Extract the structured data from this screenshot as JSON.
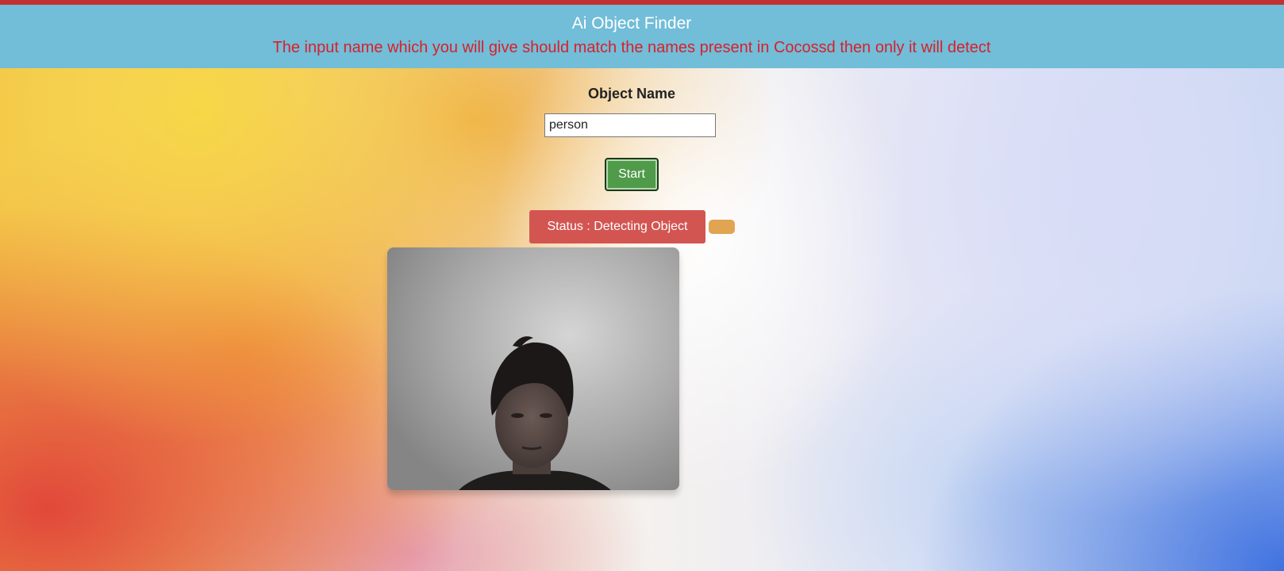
{
  "header": {
    "title": "Ai Object Finder",
    "note": "The input name which you will give should match the names present in Cocossd then only it will detect"
  },
  "form": {
    "label": "Object Name",
    "input_value": "person",
    "start_label": "Start"
  },
  "status": {
    "text": "Status : Detecting Object"
  },
  "colors": {
    "header_bg": "#72bdd8",
    "note_text": "#d8202b",
    "start_button": "#4f9b4a",
    "status_badge": "#d35552",
    "status_indicator": "#e0a452"
  }
}
